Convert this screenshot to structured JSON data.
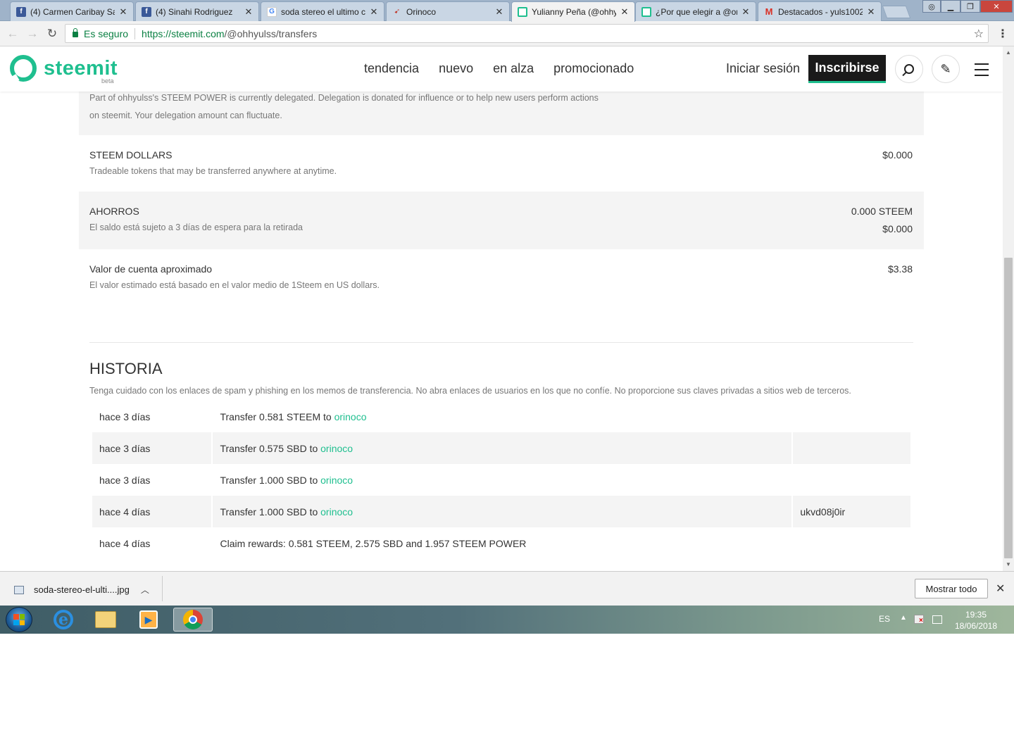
{
  "browser": {
    "tabs": [
      {
        "title": "(4) Carmen Caribay Sa",
        "favicon": "facebook-icon",
        "active": false
      },
      {
        "title": "(4) Sinahi Rodriguez",
        "favicon": "facebook-icon",
        "active": false
      },
      {
        "title": "soda stereo el ultimo c",
        "favicon": "google-icon",
        "active": false
      },
      {
        "title": "Orinoco",
        "favicon": "bird-icon",
        "active": false
      },
      {
        "title": "Yulianny Peña (@ohhy",
        "favicon": "steemit-icon",
        "active": true
      },
      {
        "title": "¿Por que elegir a @ori",
        "favicon": "steemit-icon",
        "active": false
      },
      {
        "title": "Destacados - yuls1002",
        "favicon": "gmail-icon",
        "active": false
      }
    ],
    "secure_label": "Es seguro",
    "url_host": "https://steemit.com",
    "url_path": "/@ohhyulss/transfers"
  },
  "header": {
    "logo_text": "steemit",
    "logo_badge": "beta",
    "nav": [
      "tendencia",
      "nuevo",
      "en alza",
      "promocionado"
    ],
    "signin_label": "Iniciar sesión",
    "signup_label": "Inscribirse",
    "accent": "#1fbf8f"
  },
  "wallet": {
    "delegation_note_1": "Part of ohhyulss's STEEM POWER is currently delegated. Delegation is donated for influence or to help new users perform actions",
    "delegation_note_2": "on steemit. Your delegation amount can fluctuate.",
    "steem_dollars": {
      "title": "STEEM DOLLARS",
      "desc": "Tradeable tokens that may be transferred anywhere at anytime.",
      "value": "$0.000"
    },
    "savings": {
      "title": "AHORROS",
      "desc": "El saldo está sujeto a 3 días de espera para la retirada",
      "value_steem": "0.000 STEEM",
      "value_usd": "$0.000"
    },
    "account_value": {
      "title": "Valor de cuenta aproximado",
      "desc": "El valor estimado está basado en el valor medio de 1Steem en US dollars.",
      "value": "$3.38"
    }
  },
  "history": {
    "title": "HISTORIA",
    "warning": "Tenga cuidado con los enlaces de spam y phishing en los memos de transferencia. No abra enlaces de usuarios en los que no confíe. No proporcione sus claves privadas a sitios web de terceros.",
    "rows": [
      {
        "date": "hace 3 días",
        "text": "Transfer 0.581 STEEM to ",
        "link": "orinoco",
        "memo": ""
      },
      {
        "date": "hace 3 días",
        "text": "Transfer 0.575 SBD to ",
        "link": "orinoco",
        "memo": ""
      },
      {
        "date": "hace 3 días",
        "text": "Transfer 1.000 SBD to ",
        "link": "orinoco",
        "memo": ""
      },
      {
        "date": "hace 4 días",
        "text": "Transfer 1.000 SBD to ",
        "link": "orinoco",
        "memo": "ukvd08j0ir"
      },
      {
        "date": "hace 4 días",
        "text": "Claim rewards: 0.581 STEEM, 2.575 SBD and 1.957 STEEM POWER",
        "link": "",
        "memo": ""
      }
    ]
  },
  "download_bar": {
    "filename": "soda-stereo-el-ulti....jpg",
    "show_all_label": "Mostrar todo"
  },
  "taskbar": {
    "lang": "ES",
    "time": "19:35",
    "date": "18/06/2018"
  }
}
